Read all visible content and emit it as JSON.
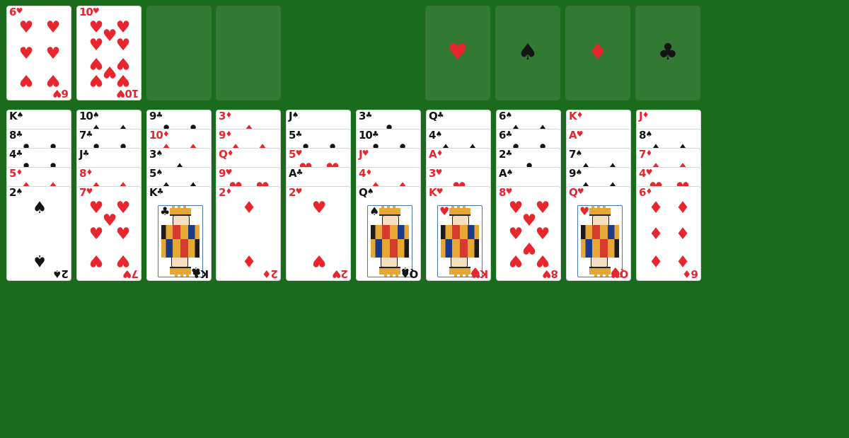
{
  "free_cells": [
    {
      "rank": "6",
      "suit": "♥",
      "color": "red"
    },
    {
      "rank": "10",
      "suit": "♥",
      "color": "red"
    },
    null,
    null
  ],
  "foundations": [
    {
      "name": "hearts",
      "symbol": "♥",
      "color": "#e8262e"
    },
    {
      "name": "spades",
      "symbol": "♠",
      "color": "#141414"
    },
    {
      "name": "diamonds",
      "symbol": "♦",
      "color": "#e8262e"
    },
    {
      "name": "clubs",
      "symbol": "♣",
      "color": "#141414"
    }
  ],
  "tableau": [
    [
      {
        "rank": "K",
        "suit": "♠",
        "color": "black"
      },
      {
        "rank": "8",
        "suit": "♣",
        "color": "black"
      },
      {
        "rank": "4",
        "suit": "♣",
        "color": "black"
      },
      {
        "rank": "5",
        "suit": "♦",
        "color": "red"
      },
      {
        "rank": "2",
        "suit": "♠",
        "color": "black"
      }
    ],
    [
      {
        "rank": "10",
        "suit": "♠",
        "color": "black"
      },
      {
        "rank": "7",
        "suit": "♣",
        "color": "black"
      },
      {
        "rank": "J",
        "suit": "♣",
        "color": "black"
      },
      {
        "rank": "8",
        "suit": "♦",
        "color": "red"
      },
      {
        "rank": "7",
        "suit": "♥",
        "color": "red"
      }
    ],
    [
      {
        "rank": "9",
        "suit": "♣",
        "color": "black"
      },
      {
        "rank": "10",
        "suit": "♦",
        "color": "red"
      },
      {
        "rank": "3",
        "suit": "♠",
        "color": "black"
      },
      {
        "rank": "5",
        "suit": "♠",
        "color": "black"
      },
      {
        "rank": "K",
        "suit": "♣",
        "color": "black"
      }
    ],
    [
      {
        "rank": "3",
        "suit": "♦",
        "color": "red"
      },
      {
        "rank": "9",
        "suit": "♦",
        "color": "red"
      },
      {
        "rank": "Q",
        "suit": "♦",
        "color": "red"
      },
      {
        "rank": "9",
        "suit": "♥",
        "color": "red"
      },
      {
        "rank": "2",
        "suit": "♦",
        "color": "red"
      }
    ],
    [
      {
        "rank": "J",
        "suit": "♠",
        "color": "black"
      },
      {
        "rank": "5",
        "suit": "♣",
        "color": "black"
      },
      {
        "rank": "5",
        "suit": "♥",
        "color": "red"
      },
      {
        "rank": "A",
        "suit": "♣",
        "color": "black"
      },
      {
        "rank": "2",
        "suit": "♥",
        "color": "red"
      }
    ],
    [
      {
        "rank": "3",
        "suit": "♣",
        "color": "black"
      },
      {
        "rank": "10",
        "suit": "♣",
        "color": "black"
      },
      {
        "rank": "J",
        "suit": "♥",
        "color": "red"
      },
      {
        "rank": "4",
        "suit": "♦",
        "color": "red"
      },
      {
        "rank": "Q",
        "suit": "♠",
        "color": "black"
      }
    ],
    [
      {
        "rank": "Q",
        "suit": "♣",
        "color": "black"
      },
      {
        "rank": "4",
        "suit": "♠",
        "color": "black"
      },
      {
        "rank": "A",
        "suit": "♦",
        "color": "red"
      },
      {
        "rank": "3",
        "suit": "♥",
        "color": "red"
      },
      {
        "rank": "K",
        "suit": "♥",
        "color": "red"
      }
    ],
    [
      {
        "rank": "6",
        "suit": "♠",
        "color": "black"
      },
      {
        "rank": "6",
        "suit": "♣",
        "color": "black"
      },
      {
        "rank": "2",
        "suit": "♣",
        "color": "black"
      },
      {
        "rank": "A",
        "suit": "♠",
        "color": "black"
      },
      {
        "rank": "8",
        "suit": "♥",
        "color": "red"
      }
    ],
    [
      {
        "rank": "K",
        "suit": "♦",
        "color": "red"
      },
      {
        "rank": "A",
        "suit": "♥",
        "color": "red"
      },
      {
        "rank": "7",
        "suit": "♠",
        "color": "black"
      },
      {
        "rank": "9",
        "suit": "♠",
        "color": "black"
      },
      {
        "rank": "Q",
        "suit": "♥",
        "color": "red"
      }
    ],
    [
      {
        "rank": "J",
        "suit": "♦",
        "color": "red"
      },
      {
        "rank": "8",
        "suit": "♠",
        "color": "black"
      },
      {
        "rank": "7",
        "suit": "♦",
        "color": "red"
      },
      {
        "rank": "4",
        "suit": "♥",
        "color": "red"
      },
      {
        "rank": "6",
        "suit": "♦",
        "color": "red"
      }
    ]
  ],
  "colors": {
    "felt": "#1b6b1c",
    "red": "#e8262e",
    "black": "#141414"
  }
}
